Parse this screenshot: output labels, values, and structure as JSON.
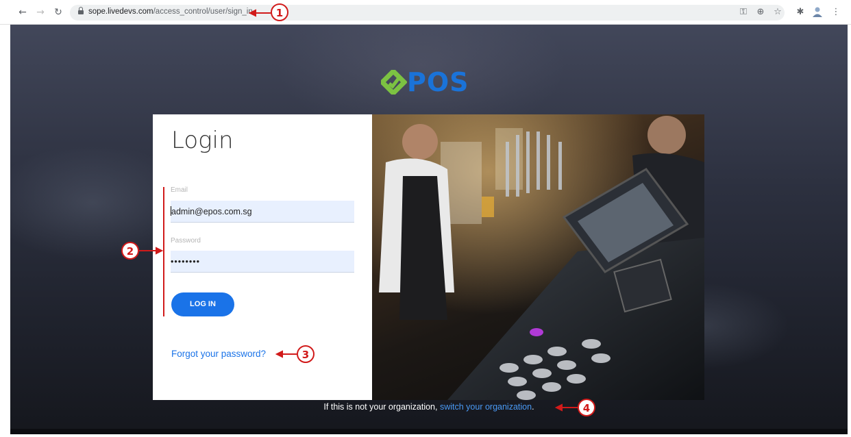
{
  "browser": {
    "url_domain": "sope.livedevs.com",
    "url_path": "/access_control/user/sign_in",
    "icons": [
      "back-icon",
      "forward-icon",
      "reload-icon",
      "lock-icon",
      "key-icon",
      "zoom-icon",
      "star-icon",
      "extensions-icon",
      "profile-icon",
      "menu-icon"
    ]
  },
  "logo": {
    "text": "POS"
  },
  "login": {
    "title": "Login",
    "email_label": "Email",
    "email_value": "admin@epos.com.sg",
    "password_label": "Password",
    "password_value": "••••••••",
    "button_label": "LOG IN",
    "forgot_label": "Forgot your password?"
  },
  "footer": {
    "prefix": "If this is not your organization,",
    "link": "switch your organization",
    "suffix": "."
  },
  "annotations": [
    "1",
    "2",
    "3",
    "4"
  ],
  "colors": {
    "accent": "#1a73e8",
    "logo_green": "#7cc242",
    "annotation_red": "#d11a1a"
  }
}
